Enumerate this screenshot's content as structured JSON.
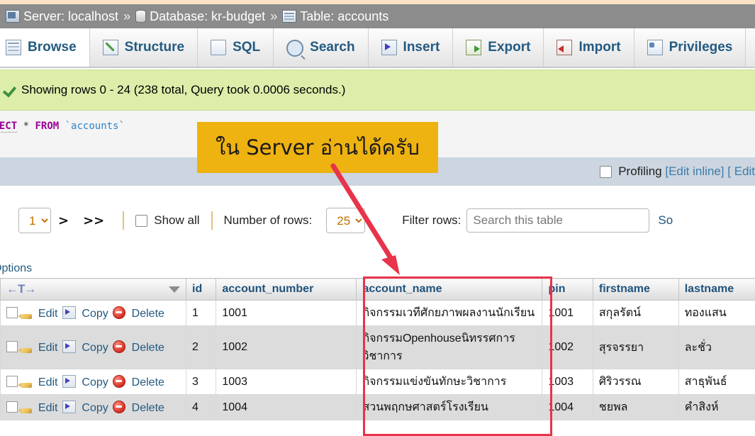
{
  "breadcrumb": {
    "server_label": "Server: localhost",
    "database_label": "Database: kr-budget",
    "table_label": "Table: accounts",
    "separator": "»"
  },
  "tabs": [
    {
      "label": "Browse",
      "icon": "browse-icon",
      "active": true
    },
    {
      "label": "Structure",
      "icon": "structure-icon",
      "active": false
    },
    {
      "label": "SQL",
      "icon": "sql-icon",
      "active": false
    },
    {
      "label": "Search",
      "icon": "search-icon",
      "active": false
    },
    {
      "label": "Insert",
      "icon": "insert-icon",
      "active": false
    },
    {
      "label": "Export",
      "icon": "export-icon",
      "active": false
    },
    {
      "label": "Import",
      "icon": "import-icon",
      "active": false
    },
    {
      "label": "Privileges",
      "icon": "privileges-icon",
      "active": false
    }
  ],
  "notice": {
    "text": "Showing rows 0 - 24 (238 total, Query took 0.0006 seconds.)",
    "icon": "success-check-icon",
    "background": "#ddeeaa"
  },
  "sql": {
    "keyword_select": "ELECT",
    "star": "*",
    "keyword_from": "FROM",
    "table": "`accounts`"
  },
  "profiling": {
    "label": "Profiling",
    "edit_inline_link": "[Edit inline]",
    "edit_link": "[ Edit",
    "checked": false
  },
  "controls": {
    "page_value": "1",
    "page_options": [
      "1"
    ],
    "next_label": ">",
    "last_label": ">>",
    "show_all_label": "Show all",
    "show_all_checked": false,
    "number_of_rows_label": "Number of rows:",
    "rows_value": "25",
    "rows_options": [
      "25"
    ],
    "filter_label": "Filter rows:",
    "filter_placeholder": "Search this table",
    "filter_value": "",
    "sort_label": "So"
  },
  "options_label": "Options",
  "table": {
    "sort_icon": "triangle-arrow-icon",
    "columns": [
      "id",
      "account_number",
      "account_name",
      "pin",
      "firstname",
      "lastname"
    ],
    "row_actions": [
      "Edit",
      "Copy",
      "Delete"
    ],
    "rows": [
      {
        "id": "1",
        "account_number": "1001",
        "account_name": "กิจกรรมเวทีศักยภาพผลงานนักเรียน",
        "pin": "1001",
        "firstname": "สกุลรัตน์",
        "lastname": "ทองแสน"
      },
      {
        "id": "2",
        "account_number": "1002",
        "account_name": "กิจกรรมOpenhouseนิทรรศการวิชาการ",
        "pin": "1002",
        "firstname": "สุรจรรยา",
        "lastname": "ละชั่ว"
      },
      {
        "id": "3",
        "account_number": "1003",
        "account_name": "กิจกรรมแข่งขันทักษะวิชาการ",
        "pin": "1003",
        "firstname": "ศิริวรรณ",
        "lastname": "สาธุพันธ์"
      },
      {
        "id": "4",
        "account_number": "1004",
        "account_name": "สวนพฤกษศาสตร์โรงเรียน",
        "pin": "1004",
        "firstname": "ชยพล",
        "lastname": "คำสิงห์"
      }
    ]
  },
  "annotations": {
    "callout_text": "ใน Server อ่านได้ครับ",
    "callout_color": "#eeb211",
    "arrow_color": "#e8334a",
    "highlight_color": "#e8334a"
  }
}
